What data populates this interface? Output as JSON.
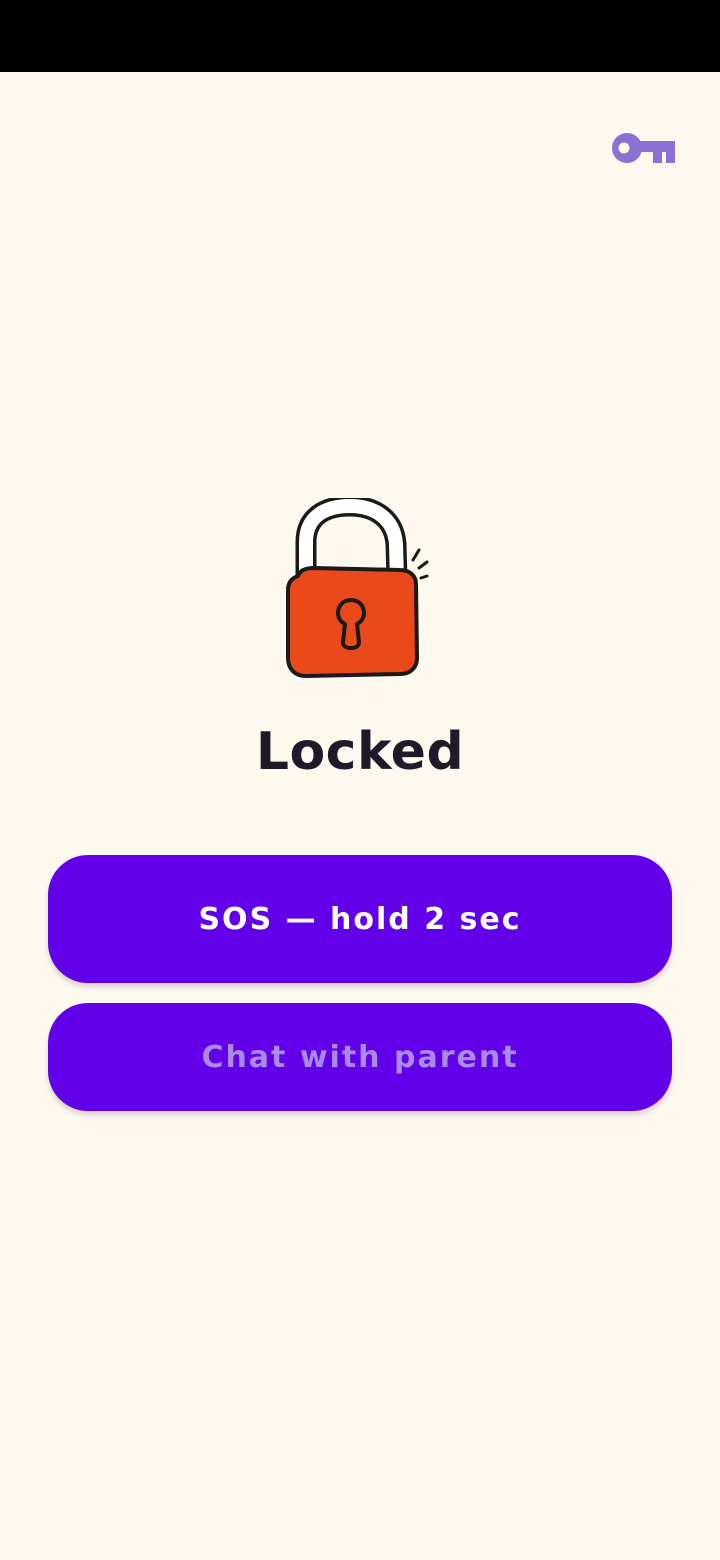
{
  "colors": {
    "background": "#fef9ee",
    "accent": "#6200ea",
    "key_icon": "#8c70d6",
    "lock_body": "#ea4a1a",
    "sos_text": "#ffffff",
    "chat_text": "#a98be6"
  },
  "header": {
    "key_icon": "key-icon"
  },
  "main": {
    "illustration": "padlock-icon",
    "title": "Locked"
  },
  "actions": {
    "sos_label": "SOS — hold 2 sec",
    "chat_label": "Chat with parent"
  }
}
